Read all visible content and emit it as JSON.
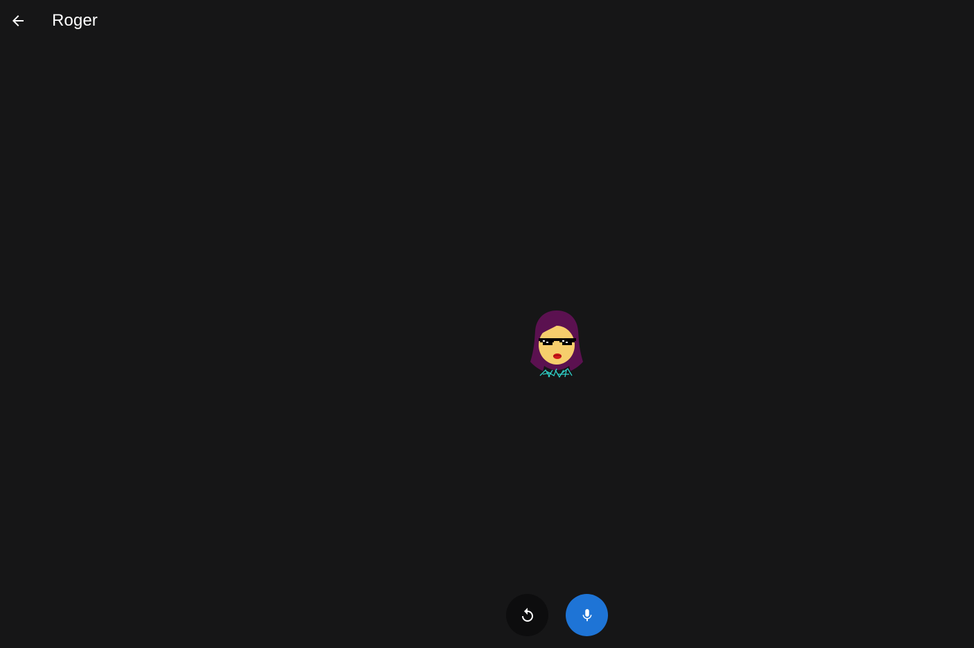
{
  "header": {
    "back_icon": "arrow-left-icon",
    "title": "Roger"
  },
  "avatar": {
    "icon": "character-avatar",
    "colors": {
      "hair": "#5b1150",
      "skin": "#f6ce6c",
      "lips": "#d11a1a",
      "sunglasses": "#000000",
      "shirt_pattern": "#2fd0c8"
    }
  },
  "controls": {
    "reset_icon": "refresh-icon",
    "mic_icon": "microphone-icon",
    "mic_color": "#1e74d6",
    "reset_color": "#0d0d0e"
  },
  "theme": {
    "background": "#161617",
    "text": "#ffffff"
  }
}
